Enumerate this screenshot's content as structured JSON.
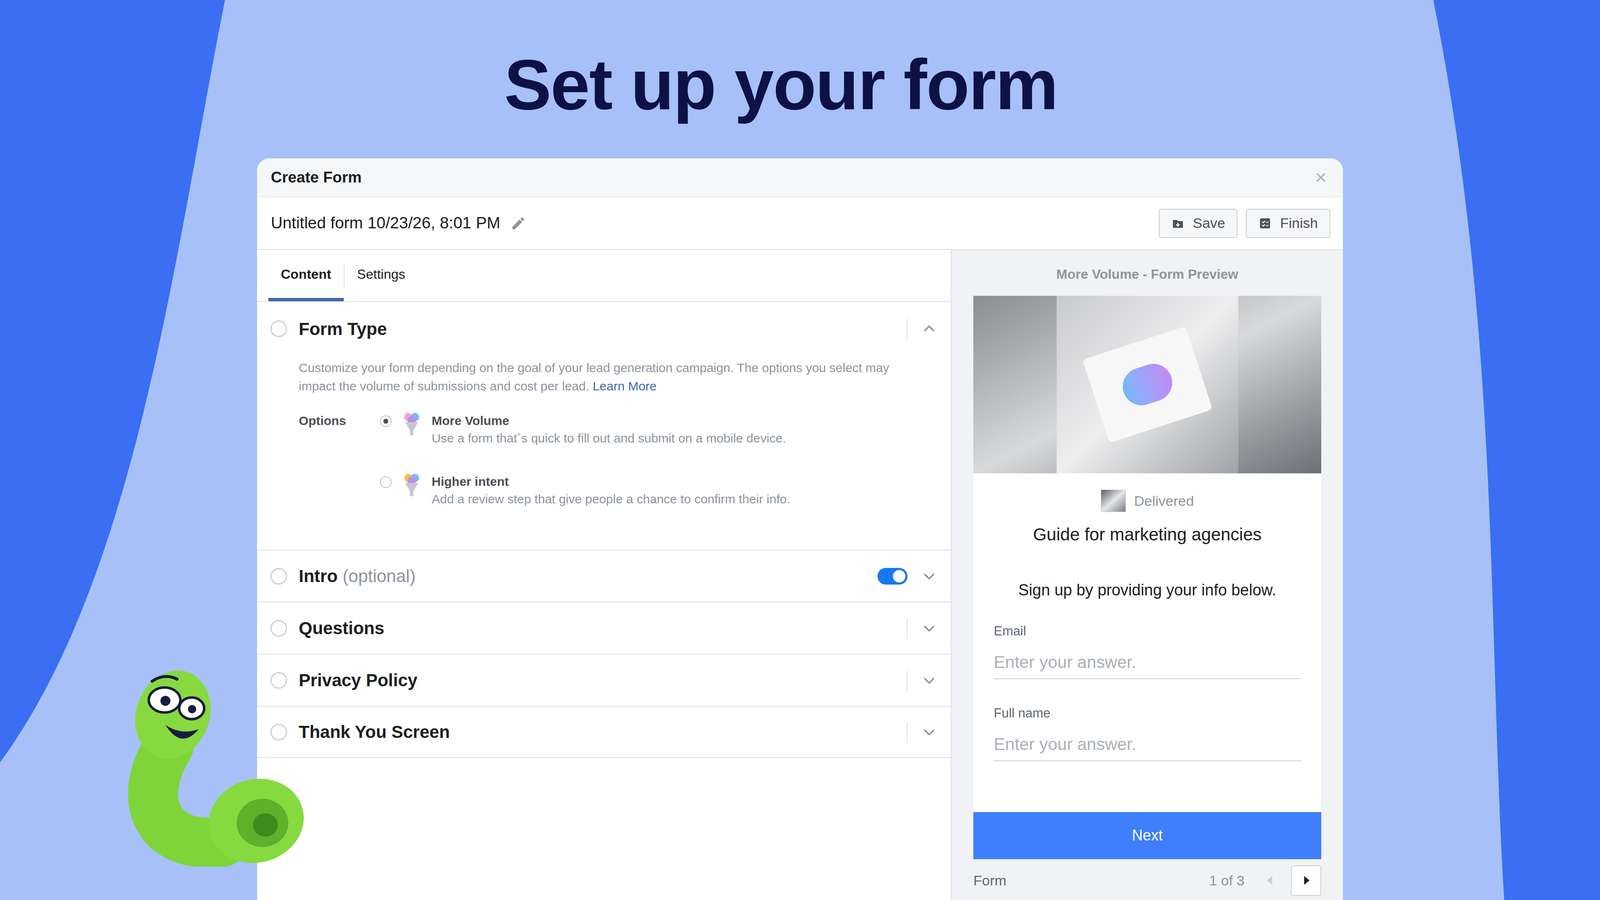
{
  "heading": "Set up your form",
  "window": {
    "title": "Create Form",
    "close": "×"
  },
  "form_name": "Untitled form 10/23/26, 8:01 PM",
  "buttons": [
    {
      "label": "Save",
      "kind": "save"
    },
    {
      "label": "Finish",
      "kind": "finish"
    }
  ],
  "tabs": [
    {
      "label": "Content",
      "selected": true
    },
    {
      "label": "Settings",
      "selected": false
    }
  ],
  "form_type": {
    "title": "Form Type",
    "expanded": true,
    "completed": false,
    "description": "Customize your form depending on the goal of your lead generation campaign. The options you select may impact the volume of submissions and cost per lead.",
    "learn_more": "Learn More",
    "options_label": "Options",
    "options": [
      {
        "title": "More Volume",
        "description": "Use a form that´s quick to fill out and submit on a mobile device.",
        "selected": true
      },
      {
        "title": "Higher intent",
        "description": "Add a review step that give people a chance to confirm their info.",
        "selected": false
      }
    ]
  },
  "sections": [
    {
      "title": "Intro",
      "suffix": "(optional)",
      "kind": "toggle",
      "on": true,
      "expanded": false,
      "completed": false
    },
    {
      "title": "Questions",
      "kind": "plain",
      "expanded": false,
      "completed": false
    },
    {
      "title": "Privacy Policy",
      "kind": "plain",
      "expanded": false,
      "completed": false
    },
    {
      "title": "Thank You Screen",
      "kind": "plain",
      "expanded": false,
      "completed": false
    }
  ],
  "preview": {
    "title": "More Volume - Form Preview",
    "brand": "Delivered",
    "headline": "Guide for marketing agencies",
    "subtitle": "Sign up by providing your info below.",
    "fields": [
      {
        "label": "Email",
        "placeholder": "Enter your answer."
      },
      {
        "label": "Full name",
        "placeholder": "Enter your answer."
      }
    ],
    "button": "Next",
    "footer_label": "Form",
    "pager": {
      "page": "1 of 3",
      "prev_enabled": false,
      "next_enabled": true
    }
  }
}
